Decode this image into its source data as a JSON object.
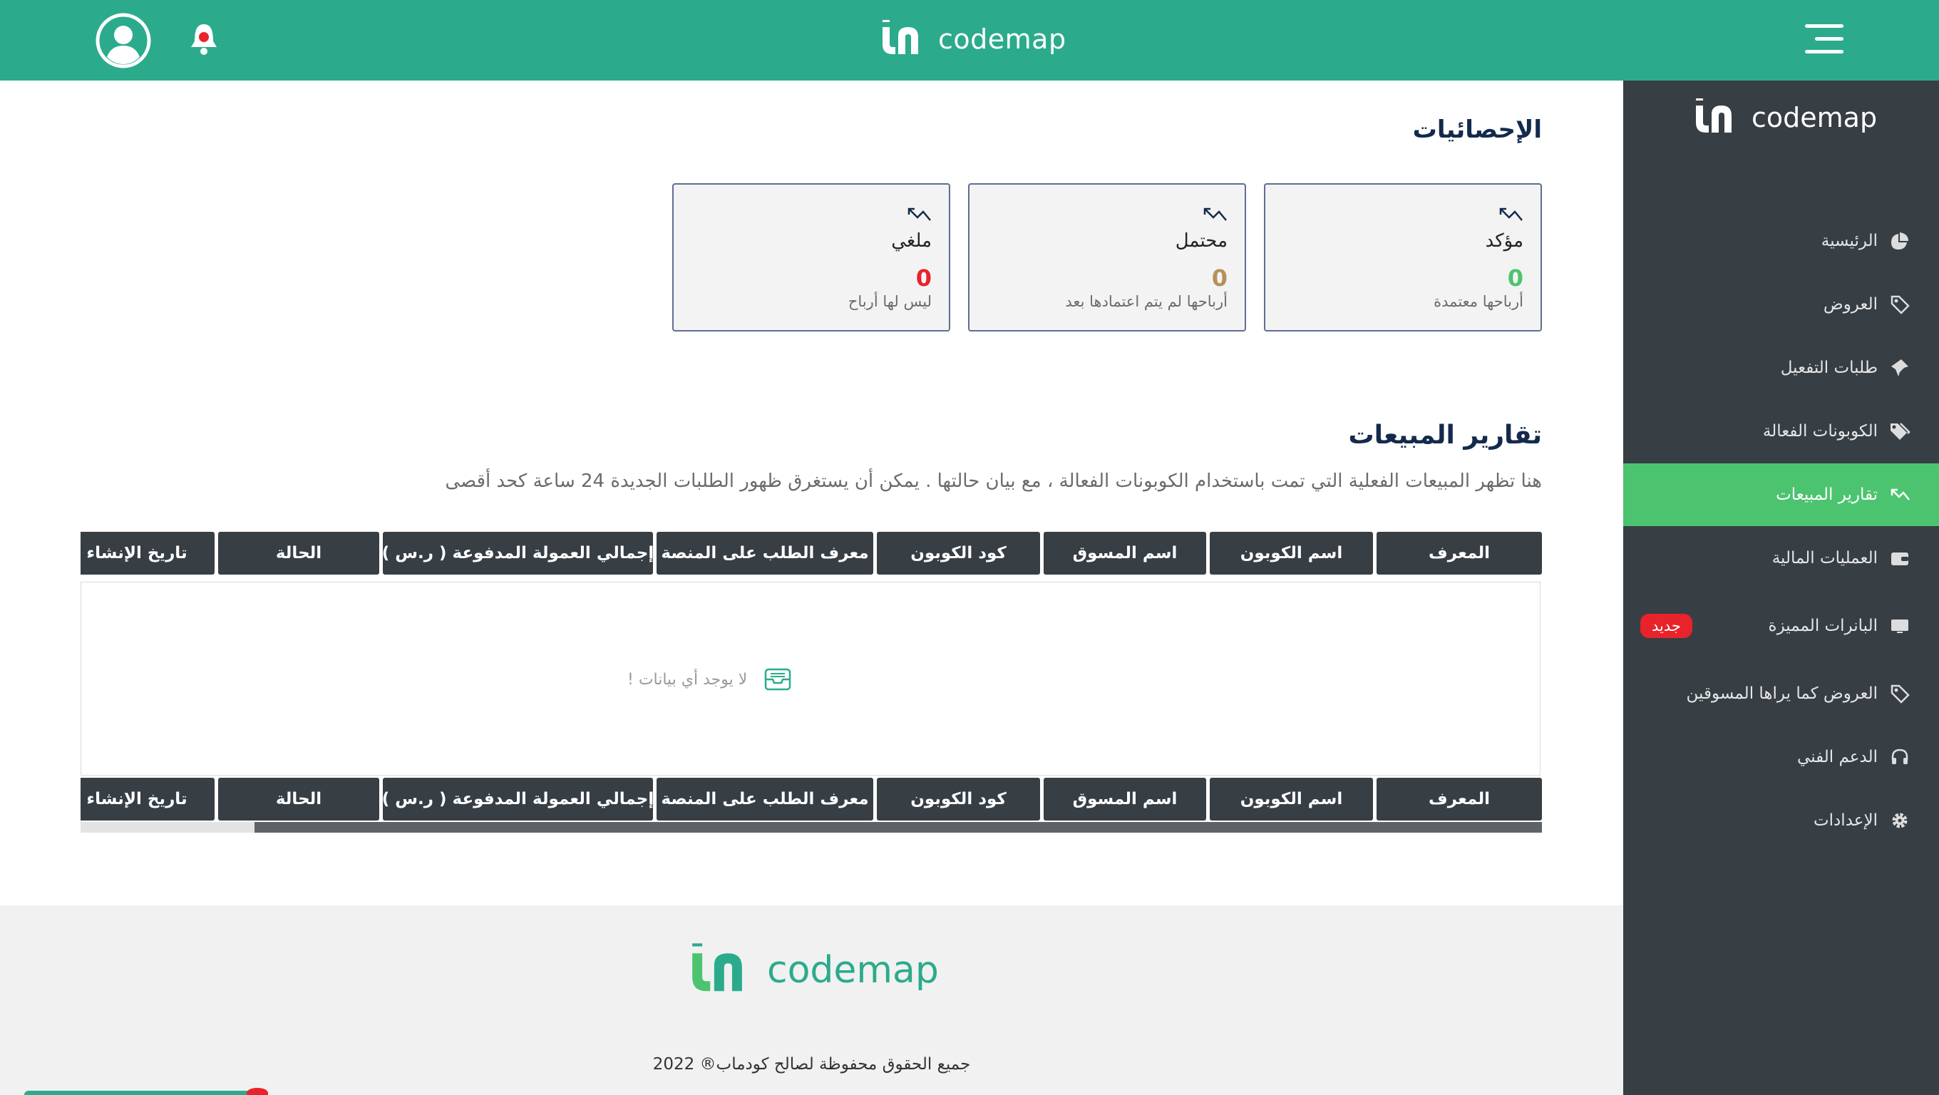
{
  "brand": {
    "name": "codemap",
    "accent": "#2bab8c",
    "active_nav": "#4cc46f",
    "sidebar_bg": "#373e44",
    "badge": "#e8232b"
  },
  "header": {
    "menu_icon": "hamburger-icon",
    "bell_icon": "bell-icon",
    "avatar_icon": "user-circle-icon"
  },
  "sidebar": {
    "items": [
      {
        "label": "الرئيسية",
        "icon": "pie-chart-icon"
      },
      {
        "label": "العروض",
        "icon": "tag-icon"
      },
      {
        "label": "طلبات التفعيل",
        "icon": "pin-icon"
      },
      {
        "label": "الكوبونات الفعالة",
        "icon": "tags-icon"
      },
      {
        "label": "تقارير المبيعات",
        "icon": "trend-icon",
        "active": true
      },
      {
        "label": "العمليات المالية",
        "icon": "wallet-icon"
      },
      {
        "label": "البانرات المميزة",
        "icon": "monitor-icon",
        "badge": "جديد"
      },
      {
        "label": "العروض كما يراها المسوقين",
        "icon": "tag-icon"
      },
      {
        "label": "الدعم الفني",
        "icon": "headset-icon"
      },
      {
        "label": "الإعدادات",
        "icon": "gear-icon"
      }
    ]
  },
  "stats": {
    "title": "الإحصائيات",
    "cards": [
      {
        "title": "مؤكد",
        "value": "0",
        "subtitle": "أرباحها معتمدة",
        "color": "#4cc46f"
      },
      {
        "title": "محتمل",
        "value": "0",
        "subtitle": "أرباحها لم يتم اعتمادها بعد",
        "color": "#b5915a"
      },
      {
        "title": "ملغي",
        "value": "0",
        "subtitle": "ليس لها أرباح",
        "color": "#e8232b"
      }
    ]
  },
  "sales": {
    "title": "تقارير المبيعات",
    "description": "هنا تظهر المبيعات الفعلية التي تمت باستخدام الكوبونات الفعالة ، مع بيان حالتها . يمكن أن يستغرق ظهور الطلبات الجديدة 24 ساعة كحد أقصى",
    "columns": [
      "المعرف",
      "اسم الكوبون",
      "اسم المسوق",
      "كود الكوبون",
      "معرف الطلب على المنصة",
      "إجمالي العمولة المدفوعة ( ر.س )",
      "الحالة",
      "تاريخ الإنشاء"
    ],
    "empty_text": "لا يوجد أي بيانات !"
  },
  "footer": {
    "copyright": "جميع الحقوق محفوظة لصالح كودماب® 2022"
  }
}
